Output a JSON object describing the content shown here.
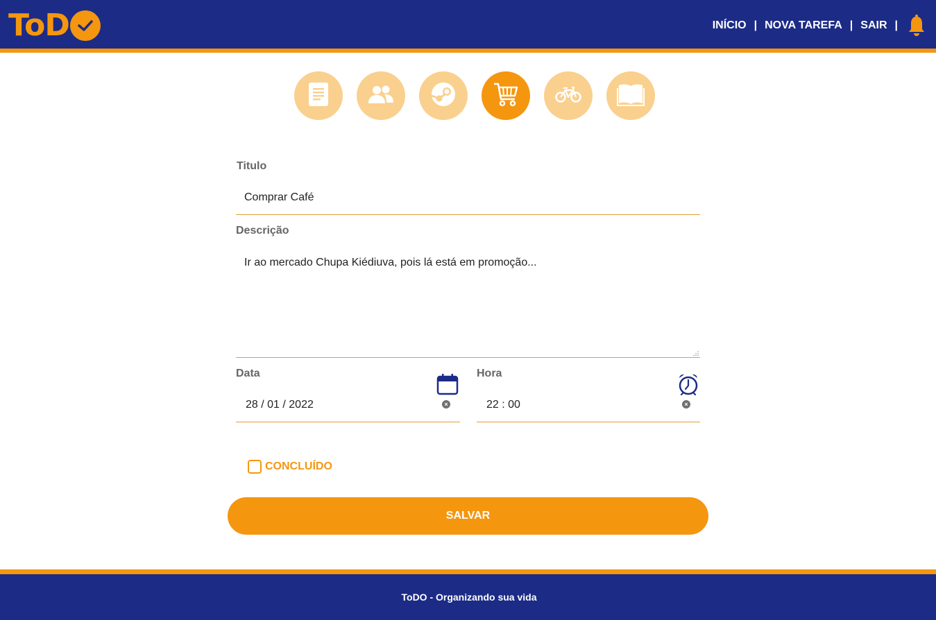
{
  "brand": {
    "logo_text": "ToD",
    "logo_icon": "check-circle-icon",
    "primary_color": "#1c2b86",
    "accent_color": "#f5960f"
  },
  "nav": {
    "items": [
      "INÍCIO",
      "NOVA TAREFA",
      "SAIR"
    ],
    "separator": "|",
    "notification_icon": "bell-icon"
  },
  "categories": {
    "items": [
      {
        "icon": "document-icon",
        "selected": false
      },
      {
        "icon": "people-icon",
        "selected": false
      },
      {
        "icon": "steam-icon",
        "selected": false
      },
      {
        "icon": "shopping-cart-icon",
        "selected": true
      },
      {
        "icon": "bicycle-icon",
        "selected": false
      },
      {
        "icon": "book-icon",
        "selected": false
      }
    ]
  },
  "form": {
    "title_label": "Titulo",
    "title_value": "Comprar Café",
    "description_label": "Descrição",
    "description_value": "Ir ao mercado Chupa Kiédiuva, pois lá está em promoção...",
    "date_label": "Data",
    "date_value": "28 / 01 / 2022",
    "date_icon": "calendar-icon",
    "time_label": "Hora",
    "time_value": "22 : 00",
    "time_icon": "alarm-clock-icon",
    "clear_icon": "clear-icon",
    "done_label": "CONCLUÍDO",
    "done_checked": false,
    "save_label": "SALVAR"
  },
  "footer": {
    "text": "ToDO - Organizando sua vida"
  }
}
